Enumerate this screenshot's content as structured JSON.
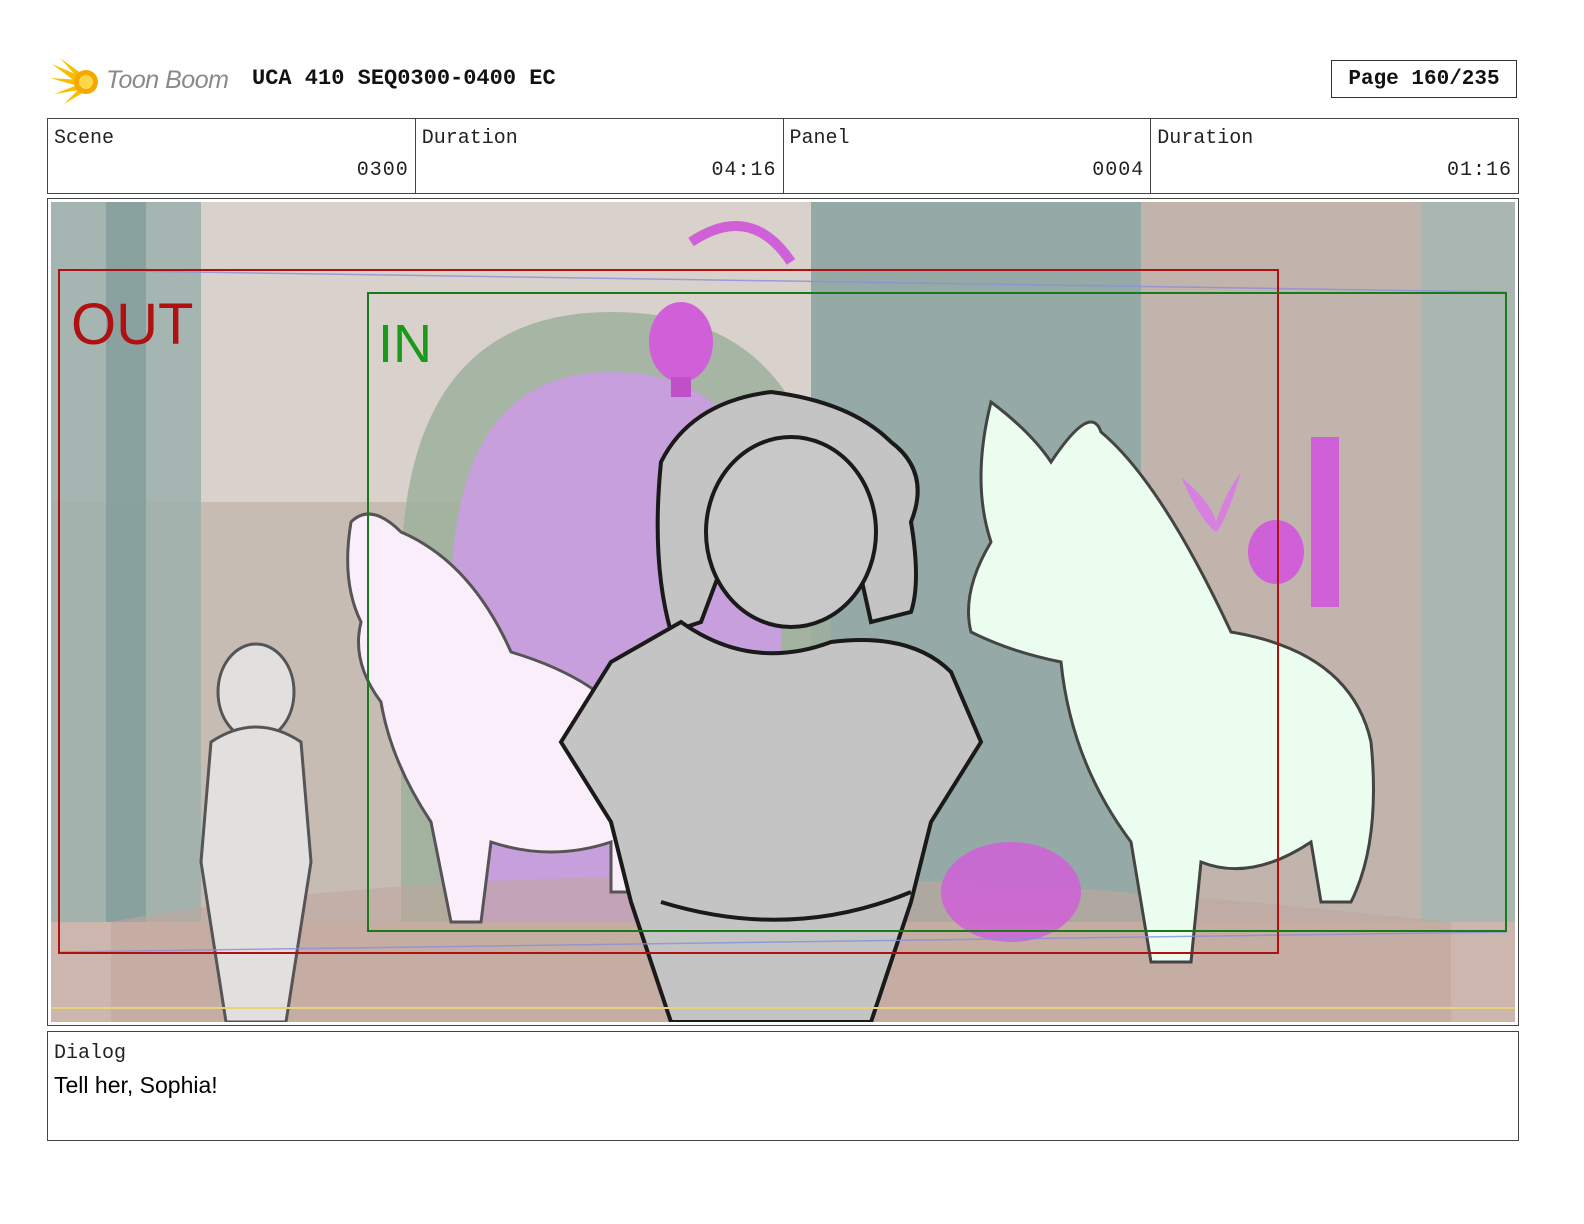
{
  "header": {
    "logo_text": "Toon Boom",
    "doc_title": "UCA 410 SEQ0300-0400 EC",
    "page_label": "Page 160/235"
  },
  "info": {
    "scene_label": "Scene",
    "scene_value": "0300",
    "scene_duration_label": "Duration",
    "scene_duration_value": "04:16",
    "panel_label": "Panel",
    "panel_value": "0004",
    "panel_duration_label": "Duration",
    "panel_duration_value": "01:16"
  },
  "panel": {
    "out_label": "OUT",
    "in_label": "IN",
    "colors": {
      "out_frame": "#b01010",
      "in_frame": "#1a7a1a",
      "bg_wall": "#c9beb5",
      "bg_teal": "#8fa8a4",
      "magenta": "#d060d8",
      "pink_unicorn": "#fbeefb",
      "green_unicorn": "#eafdee"
    }
  },
  "dialog": {
    "label": "Dialog",
    "text": "Tell her, Sophia!"
  }
}
